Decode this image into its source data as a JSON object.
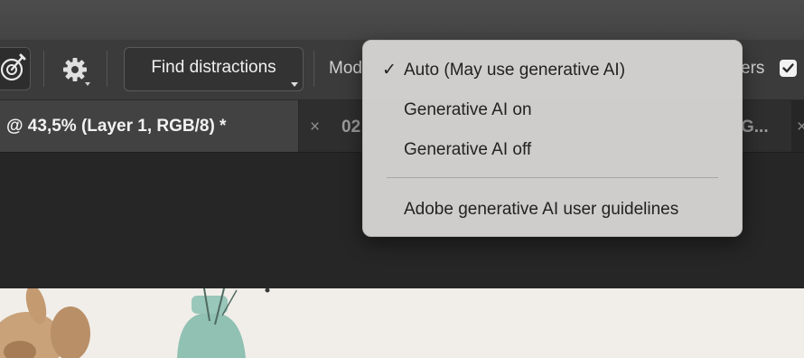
{
  "options_bar": {
    "find_distractions_label": "Find distractions",
    "mode_label": "Mod",
    "layers_label": "ers",
    "checkbox_checked": true
  },
  "tabs": {
    "active_label": "@ 43,5% (Layer 1, RGB/8) *",
    "second_label": "02",
    "third_label": "G...",
    "close_symbol": "×"
  },
  "mode_menu": {
    "items": [
      {
        "label": "Auto (May use generative AI)",
        "checked": true,
        "check_symbol": "✓"
      },
      {
        "label": "Generative AI on",
        "checked": false
      },
      {
        "label": "Generative AI off",
        "checked": false
      },
      {
        "label": "Adobe generative AI user guidelines",
        "checked": false
      }
    ]
  },
  "colors": {
    "app_background": "#262626",
    "options_bar": "#3b3b3b",
    "active_tab": "#424242",
    "menu_background": "#d6d4d2",
    "photo_background": "#f1eeea"
  }
}
